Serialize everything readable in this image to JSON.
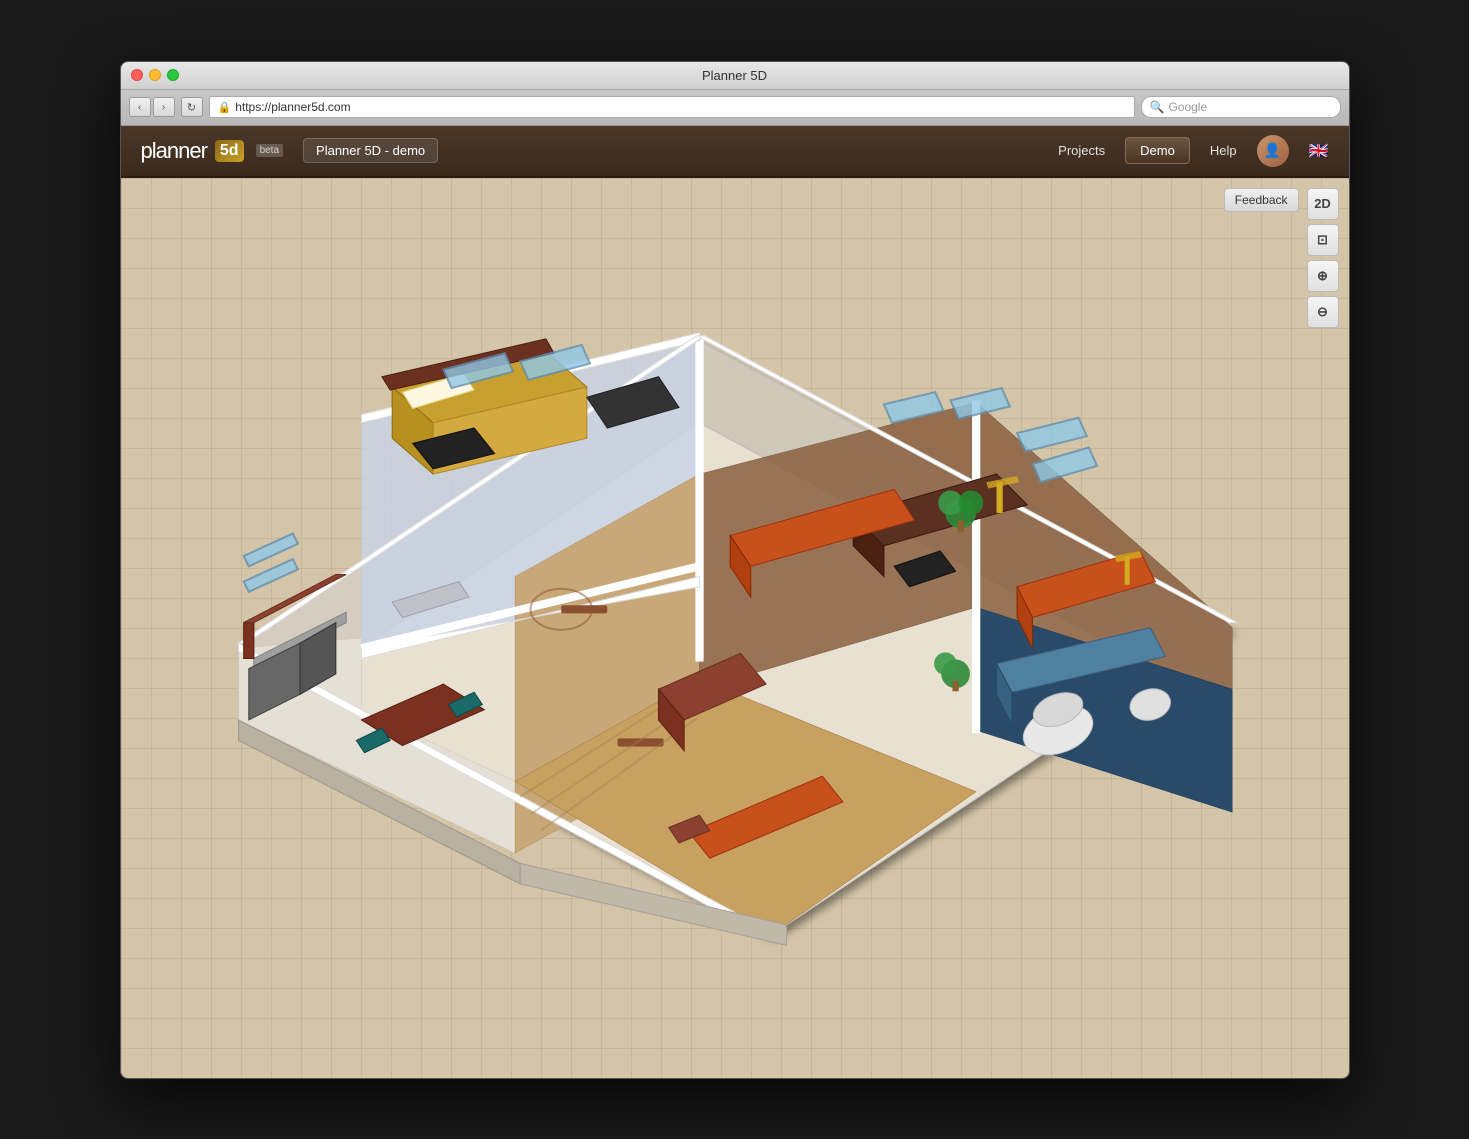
{
  "window": {
    "title": "Planner 5D",
    "url": "https://planner5d.com",
    "search_placeholder": "Google"
  },
  "header": {
    "logo_text": "planner",
    "logo_5d": "5d",
    "beta": "beta",
    "project_name": "Planner 5D - demo",
    "nav_projects": "Projects",
    "nav_demo": "Demo",
    "nav_help": "Help"
  },
  "canvas": {
    "feedback_label": "Feedback",
    "toolbar": {
      "view_2d": "2D",
      "camera_icon": "📷",
      "zoom_in_icon": "⊕",
      "zoom_out_icon": "⊖"
    }
  }
}
